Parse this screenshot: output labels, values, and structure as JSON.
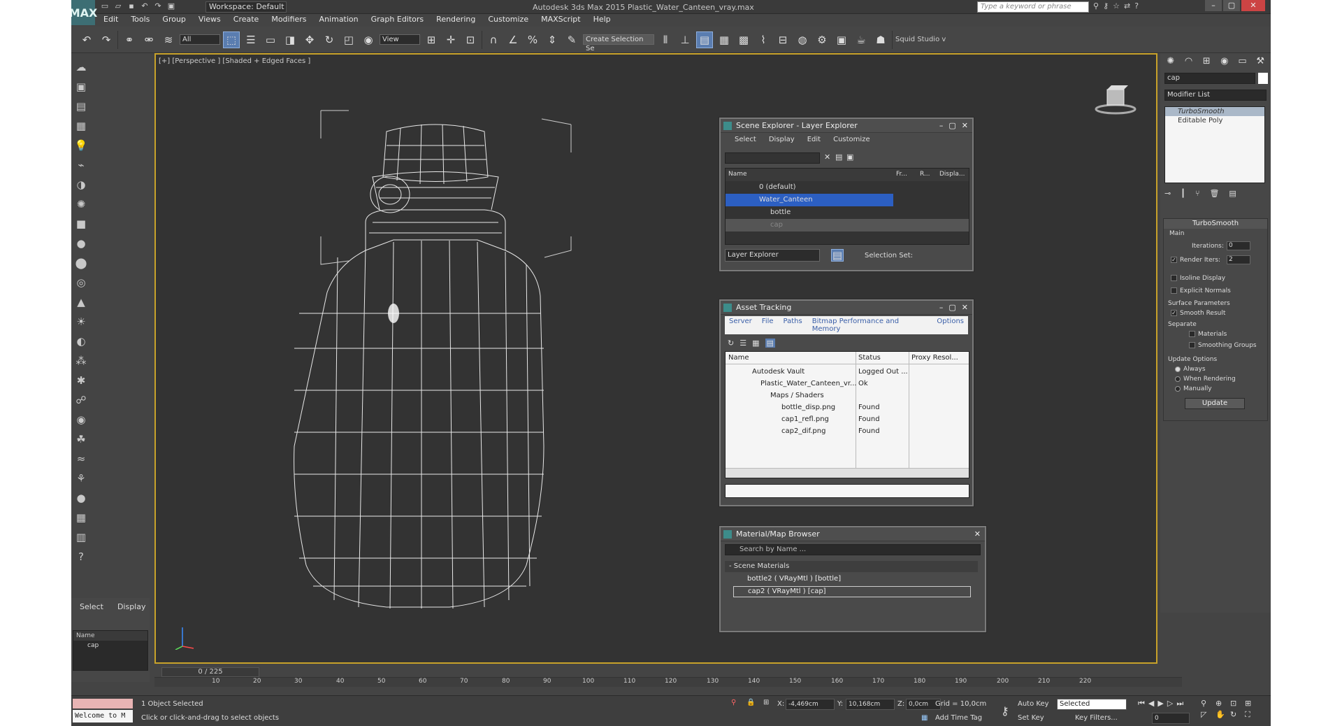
{
  "app": {
    "title": "Autodesk 3ds Max  2015     Plastic_Water_Canteen_vray.max",
    "logo": "MAX",
    "workspace": "Workspace: Default",
    "search_placeholder": "Type a keyword or phrase"
  },
  "menu": [
    "Edit",
    "Tools",
    "Group",
    "Views",
    "Create",
    "Modifiers",
    "Animation",
    "Graph Editors",
    "Rendering",
    "Customize",
    "MAXScript",
    "Help"
  ],
  "toolbar": {
    "selection_filter": "All",
    "ref_coord": "View",
    "named_selection": "Create Selection Se",
    "render_label": "Squid Studio v"
  },
  "viewport": {
    "label": "[+] [Perspective ] [Shaded + Edged Faces ]"
  },
  "left_panel": {
    "tabs": [
      "Select",
      "Display"
    ],
    "header": "Name",
    "item": "cap"
  },
  "scene_explorer": {
    "title": "Scene Explorer - Layer Explorer",
    "menu": [
      "Select",
      "Display",
      "Edit",
      "Customize"
    ],
    "columns": [
      "Name",
      "Fr...",
      "R...",
      "Displa..."
    ],
    "rows": [
      "0 (default)",
      "Water_Canteen",
      "bottle",
      "cap"
    ],
    "footer_dropdown": "Layer Explorer",
    "selection_set_label": "Selection Set:"
  },
  "asset_tracking": {
    "title": "Asset Tracking",
    "menu": [
      "Server",
      "File",
      "Paths",
      "Bitmap Performance and Memory",
      "Options"
    ],
    "columns": [
      "Name",
      "Status",
      "Proxy Resol..."
    ],
    "rows": [
      {
        "name": "Autodesk Vault",
        "status": "Logged Out ..."
      },
      {
        "name": "Plastic_Water_Canteen_vr...",
        "status": "Ok"
      },
      {
        "name": "Maps / Shaders",
        "status": ""
      },
      {
        "name": "bottle_disp.png",
        "status": "Found"
      },
      {
        "name": "cap1_refl.png",
        "status": "Found"
      },
      {
        "name": "cap2_dif.png",
        "status": "Found"
      }
    ]
  },
  "material_browser": {
    "title": "Material/Map Browser",
    "search_placeholder": "Search by Name ...",
    "group": "- Scene Materials",
    "items": [
      "bottle2  ( VRayMtl ) [bottle]",
      "cap2  ( VRayMtl ) [cap]"
    ]
  },
  "command_panel": {
    "object_name": "cap",
    "modifier_list": "Modifier List",
    "stack": [
      "TurboSmooth",
      "Editable Poly"
    ],
    "turbosmooth": {
      "title": "TurboSmooth",
      "main": "Main",
      "iterations_label": "Iterations:",
      "iterations": "0",
      "render_iters_label": "Render Iters:",
      "render_iters": "2",
      "isoline": "Isoline Display",
      "explicit_normals": "Explicit Normals",
      "surface_params": "Surface Parameters",
      "smooth_result": "Smooth Result",
      "separate": "Separate",
      "materials": "Materials",
      "smoothing_groups": "Smoothing Groups",
      "update_options": "Update Options",
      "always": "Always",
      "when_rendering": "When Rendering",
      "manually": "Manually",
      "update_button": "Update"
    }
  },
  "timeline": {
    "slider": "0 / 225",
    "ticks": [
      "10",
      "20",
      "30",
      "40",
      "50",
      "60",
      "70",
      "80",
      "90",
      "100",
      "110",
      "120",
      "130",
      "140",
      "150",
      "160",
      "170",
      "180",
      "190",
      "200",
      "210",
      "220"
    ]
  },
  "status": {
    "welcome": "Welcome to M",
    "selected": "1 Object Selected",
    "prompt": "Click or click-and-drag to select objects",
    "x_label": "X:",
    "x_value": "-4,469cm",
    "y_label": "Y:",
    "y_value": "10,168cm",
    "z_label": "Z:",
    "z_value": "0,0cm",
    "grid": "Grid = 10,0cm",
    "add_time_tag": "Add Time Tag",
    "auto_key": "Auto Key",
    "selected_dropdown": "Selected",
    "set_key": "Set Key",
    "key_filters": "Key Filters...",
    "frame": "0"
  }
}
